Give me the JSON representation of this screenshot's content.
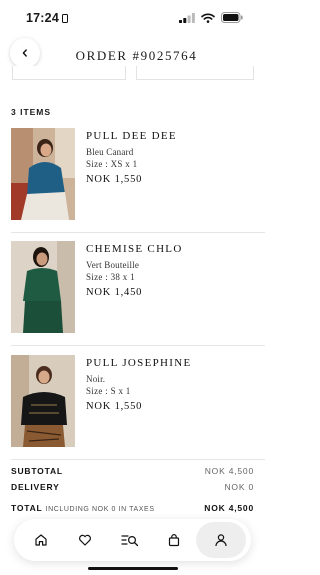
{
  "status_bar": {
    "time": "17:24"
  },
  "header": {
    "title": "ORDER #9025764",
    "back_icon": "chevron-left-icon"
  },
  "items_count": "3 ITEMS",
  "products": [
    {
      "name": "PULL DEE DEE",
      "color": "Bleu Canard",
      "size": "Size : XS x 1",
      "price": "NOK 1,550",
      "garment_color": "#1f5f86"
    },
    {
      "name": "CHEMISE CHLO",
      "color": "Vert Bouteille",
      "size": "Size : 38 x 1",
      "price": "NOK 1,450",
      "garment_color": "#1f5b43"
    },
    {
      "name": "PULL JOSEPHINE",
      "color": "Noir.",
      "size": "Size : S x 1",
      "price": "NOK 1,550",
      "garment_color": "#161616"
    }
  ],
  "totals": {
    "subtotal_label": "SUBTOTAL",
    "subtotal_value": "NOK 4,500",
    "delivery_label": "DELIVERY",
    "delivery_value": "NOK 0",
    "total_label": "TOTAL",
    "total_sub": "INCLUDING NOK 0 IN TAXES",
    "total_value": "NOK 4,500"
  },
  "nav": {
    "items": [
      {
        "icon": "home-icon"
      },
      {
        "icon": "heart-icon"
      },
      {
        "icon": "search-list-icon"
      },
      {
        "icon": "bag-icon"
      },
      {
        "icon": "user-icon",
        "active": true
      }
    ]
  }
}
